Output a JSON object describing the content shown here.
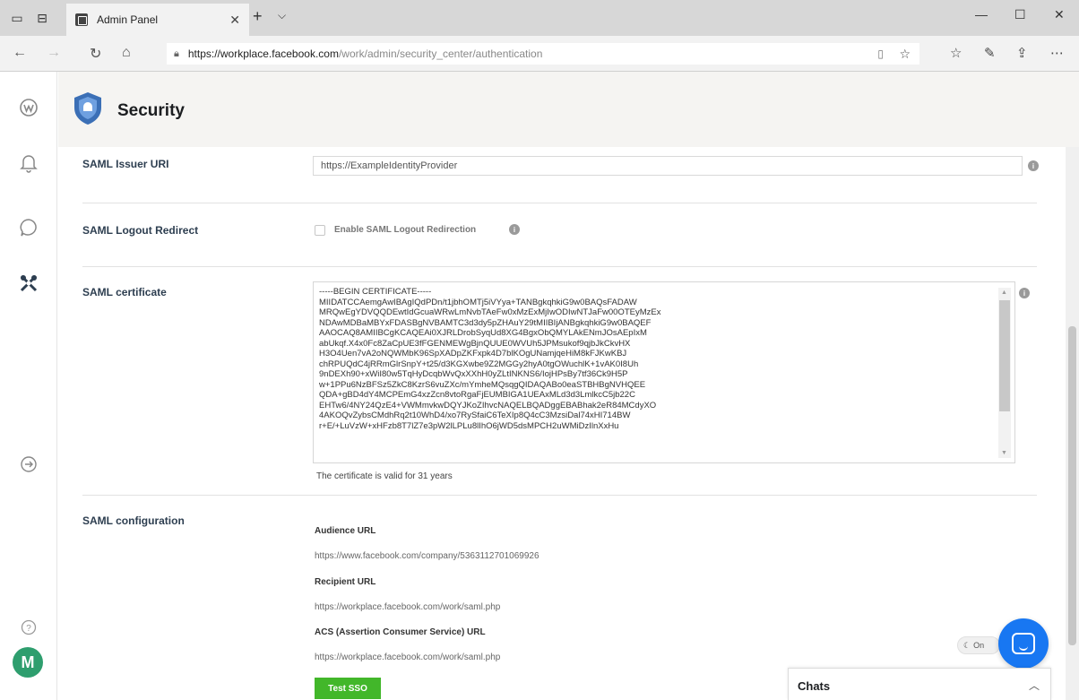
{
  "browser": {
    "tab_title": "Admin Panel",
    "tab_close": "✕",
    "new_tab": "+",
    "url_host": "https://workplace.facebook.com",
    "url_path": "/work/admin/security_center/authentication"
  },
  "header": {
    "title": "Security"
  },
  "fields": {
    "issuer_label": "SAML Issuer URI",
    "issuer_value": "https://ExampleIdentityProvider",
    "logout_label": "SAML Logout Redirect",
    "logout_checkbox_label": "Enable SAML Logout Redirection",
    "cert_label": "SAML certificate",
    "cert_text": "-----BEGIN CERTIFICATE-----\nMIIDATCCAemgAwIBAgIQdPDn/t1jbhOMTj5iVYya+TANBgkqhkiG9w0BAQsFADAW\nMRQwEgYDVQQDEwtIdGcuaWRwLmNvbTAeFw0xMzExMjIwODIwNTJaFw00OTEyMzEx\nNDAwMDBaMBYxFDASBgNVBAMTC3d3dy5pZHAuY29tMIIBIjANBgkqhkiG9w0BAQEF\nAAOCAQ8AMIIBCgKCAQEAi0XJRLDrobSyqUd8XG4BgxObQMYLAkENmJOsAEpIxM\nabUkqf.X4x0Fc8ZaCpUE3fFGENMEWgBjnQUUE0WVUh5JPMsukof9qjbJkCkvHX\nH3O4Uen7vA2oNQWMbK96SpXADpZKFxpk4D7blKOgUNamjqeHiM8kFJKwKBJ\nchRPUQdC4jRRmGlrSnpY+t25/d3KGXwbe9Z2MGGy2hyA0tgOWuchlK+1vAK0I8Uh\n9nDEXh90+xWiI80w5TqHyDcqbWvQxXXhH0yZLtINKNS6/IojHPsBy7tf36Ck9H5P\nw+1PPu6NzBFSz5ZkC8KzrS6vuZXc/mYmheMQsqgQIDAQABo0eaSTBHBgNVHQEE\nQDA+gBD4dY4MCPEmG4xzZcn8vtoRgaFjEUMBIGA1UEAxMLd3d3LmlkcC5jb22C\nEHTw6/4NY24QzE4+VWMmvkwDQYJKoZIhvcNAQELBQADggEBABhak2eR84MCdyXO\n4AKOQvZybsCMdhRq2t10WhD4/xo7RySfaiC6TeXIp8Q4cC3MzsiDal74xHI714BW\nr+E/+LuVzW+xHFzb8T7lZ7e3pW2lLPLu8lIhO6jWD5dsMPCH2uWMiDzIlnXxHu"
  },
  "cert_note": "The certificate is valid for 31 years",
  "config": {
    "label": "SAML configuration",
    "audience_label": "Audience URL",
    "audience_value": "https://www.facebook.com/company/5363112701069926",
    "recipient_label": "Recipient URL",
    "recipient_value": "https://workplace.facebook.com/work/saml.php",
    "acs_label": "ACS (Assertion Consumer Service) URL",
    "acs_value": "https://workplace.facebook.com/work/saml.php",
    "test_button": "Test SSO"
  },
  "chat": {
    "dnd_label": "On",
    "chats_title": "Chats"
  },
  "user": {
    "avatar_initial": "M"
  },
  "colors": {
    "accent": "#1877f2",
    "test_button": "#42b72a",
    "shield": "#3b6fb6"
  }
}
